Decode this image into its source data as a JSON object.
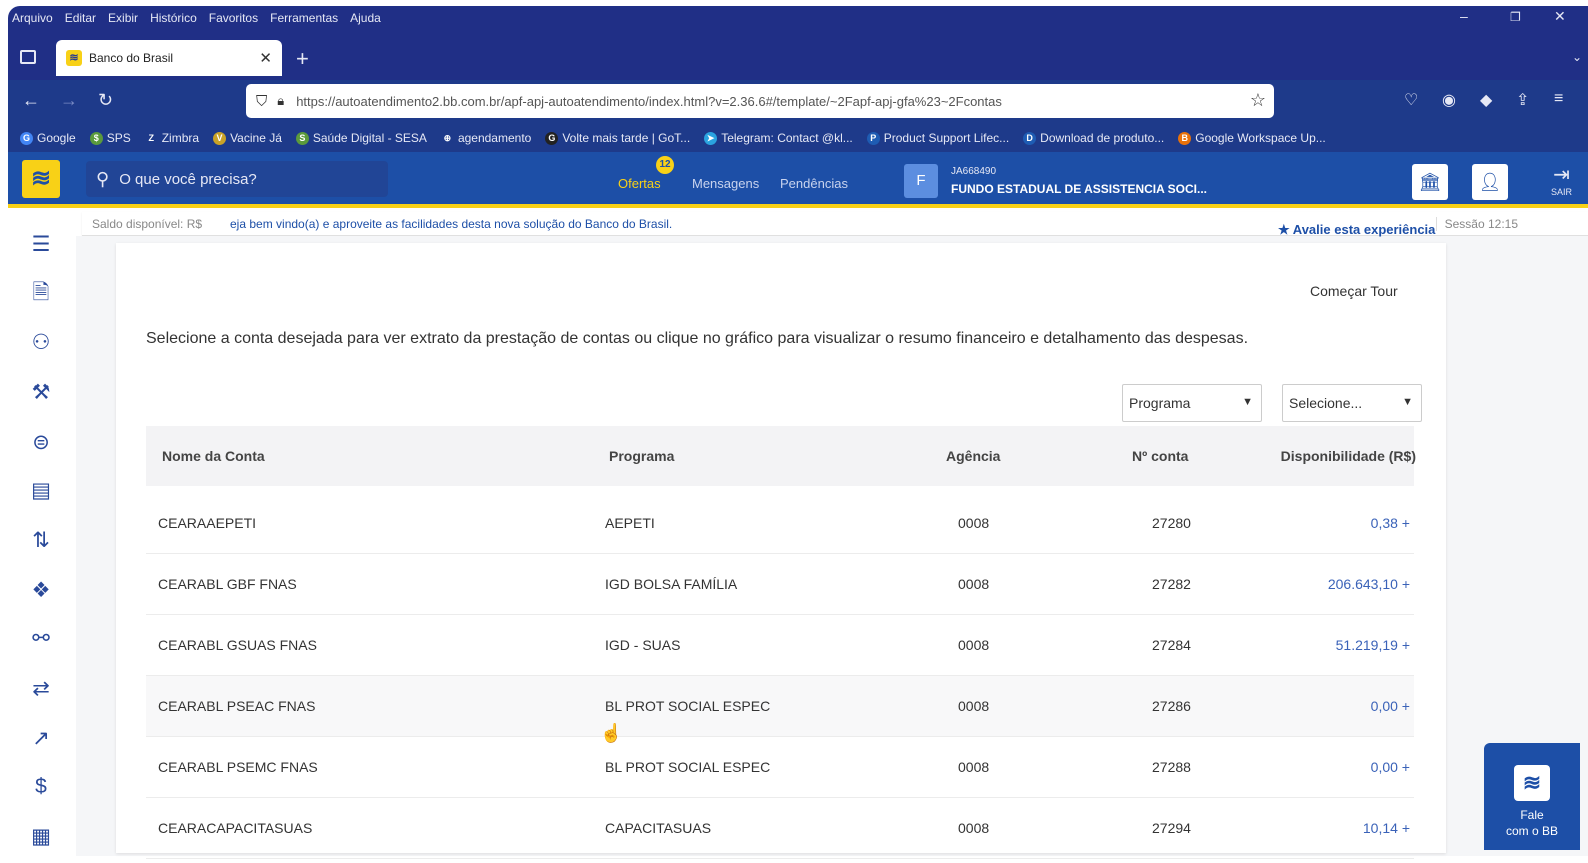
{
  "browser": {
    "menu": [
      "Arquivo",
      "Editar",
      "Exibir",
      "Histórico",
      "Favoritos",
      "Ferramentas",
      "Ajuda"
    ],
    "tab_title": "Banco do Brasil",
    "url": "https://autoatendimento2.bb.com.br/apf-apj-autoatendimento/index.html?v=2.36.6#/template/~2Fapf-apj-gfa%23~2Fcontas",
    "bookmarks": [
      {
        "label": "Google",
        "color": "#4285f4",
        "glyph": "G"
      },
      {
        "label": "SPS",
        "color": "#5b9a3c",
        "glyph": "$"
      },
      {
        "label": "Zimbra",
        "color": "#1e3a8a",
        "glyph": "Z"
      },
      {
        "label": "Vacine Já",
        "color": "#c9a227",
        "glyph": "V"
      },
      {
        "label": "Saúde Digital - SESA",
        "color": "#5b9a3c",
        "glyph": "S"
      },
      {
        "label": "agendamento",
        "color": "#1e3a8a",
        "glyph": "⊕"
      },
      {
        "label": "Volte mais tarde | GoT...",
        "color": "#222222",
        "glyph": "G"
      },
      {
        "label": "Telegram: Contact @kl...",
        "color": "#2aa3e0",
        "glyph": "➤"
      },
      {
        "label": "Product Support Lifec...",
        "color": "#1e5cb3",
        "glyph": "P"
      },
      {
        "label": "Download de produto...",
        "color": "#1e5cb3",
        "glyph": "D"
      },
      {
        "label": "Google Workspace Up...",
        "color": "#e8710a",
        "glyph": "B"
      }
    ]
  },
  "header": {
    "search_placeholder": "O que você precisa?",
    "tabs": {
      "ofertas": "Ofertas",
      "mensagens": "Mensagens",
      "pendencias": "Pendências"
    },
    "ofertas_badge": "12",
    "account": {
      "avatar": "F",
      "id": "JA668490",
      "name": "FUNDO ESTADUAL DE ASSISTENCIA SOCI..."
    },
    "sair": "SAIR"
  },
  "infostrip": {
    "saldo": "Saldo disponível: R$",
    "welcome": "eja bem vindo(a) e aproveite as facilidades desta nova solução do Banco do Brasil.",
    "sessao": "Sessão 12:15"
  },
  "main": {
    "avalie": "Avalie esta experiência",
    "tour": "Começar Tour",
    "instruction": "Selecione a conta desejada para ver extrato da prestação de contas ou clique no gráfico para visualizar o resumo financeiro e detalhamento das despesas.",
    "filter_programa": "Programa",
    "filter_selecione": "Selecione...",
    "columns": {
      "nome": "Nome da Conta",
      "programa": "Programa",
      "agencia": "Agência",
      "conta": "Nº conta",
      "disp": "Disponibilidade (R$)"
    },
    "rows": [
      {
        "nome": "CEARAAEPETI",
        "programa": "AEPETI",
        "agencia": "0008",
        "conta": "27280",
        "disp": "0,38 +"
      },
      {
        "nome": "CEARABL GBF FNAS",
        "programa": "IGD BOLSA FAMÍLIA",
        "agencia": "0008",
        "conta": "27282",
        "disp": "206.643,10 +"
      },
      {
        "nome": "CEARABL GSUAS FNAS",
        "programa": "IGD - SUAS",
        "agencia": "0008",
        "conta": "27284",
        "disp": "51.219,19 +"
      },
      {
        "nome": "CEARABL PSEAC FNAS",
        "programa": "BL PROT SOCIAL ESPEC",
        "agencia": "0008",
        "conta": "27286",
        "disp": "0,00 +"
      },
      {
        "nome": "CEARABL PSEMC FNAS",
        "programa": "BL PROT SOCIAL ESPEC",
        "agencia": "0008",
        "conta": "27288",
        "disp": "0,00 +"
      },
      {
        "nome": "CEARACAPACITASUAS",
        "programa": "CAPACITASUAS",
        "agencia": "0008",
        "conta": "27294",
        "disp": "10,14 +"
      }
    ]
  },
  "fale": {
    "line1": "Fale",
    "line2": "com o BB"
  },
  "colors": {
    "brand_blue": "#1d4fa7",
    "brand_yellow": "#f8d117",
    "chrome_blue": "#202f86"
  }
}
